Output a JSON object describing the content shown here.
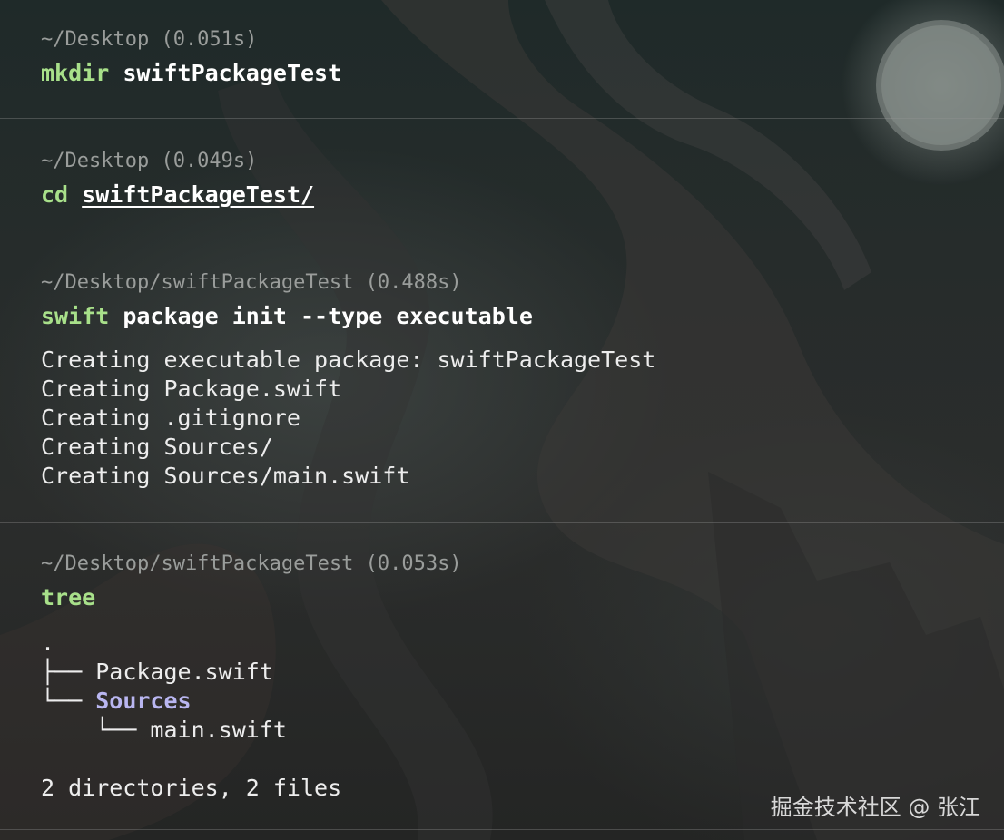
{
  "colors": {
    "background": "#262c2b",
    "path_text": "#9a9d9b",
    "command_program": "#a8e08a",
    "command_text": "#ffffff",
    "output_text": "#ededed",
    "directory_highlight": "#b9b6f0",
    "divider": "#6f6f6f"
  },
  "blocks": [
    {
      "path": "~/Desktop (0.051s)",
      "command_program": "mkdir",
      "command_args": "swiftPackageTest"
    },
    {
      "path": "~/Desktop (0.049s)",
      "command_program": "cd",
      "command_args": "swiftPackageTest/"
    },
    {
      "path": "~/Desktop/swiftPackageTest (0.488s)",
      "command_program": "swift",
      "command_args": "package init --type executable",
      "output": [
        "Creating executable package: swiftPackageTest",
        "Creating Package.swift",
        "Creating .gitignore",
        "Creating Sources/",
        "Creating Sources/main.swift"
      ]
    },
    {
      "path": "~/Desktop/swiftPackageTest (0.053s)",
      "command_program": "tree",
      "command_args": "",
      "tree": {
        "root": ".",
        "branch1_prefix": "├── ",
        "branch1_name": "Package.swift",
        "branch2_prefix": "└── ",
        "branch2_name": "Sources",
        "branch3_prefix": "    └── ",
        "branch3_name": "main.swift",
        "summary": "2 directories, 2 files"
      }
    }
  ],
  "watermark": "掘金技术社区 @ 张江"
}
